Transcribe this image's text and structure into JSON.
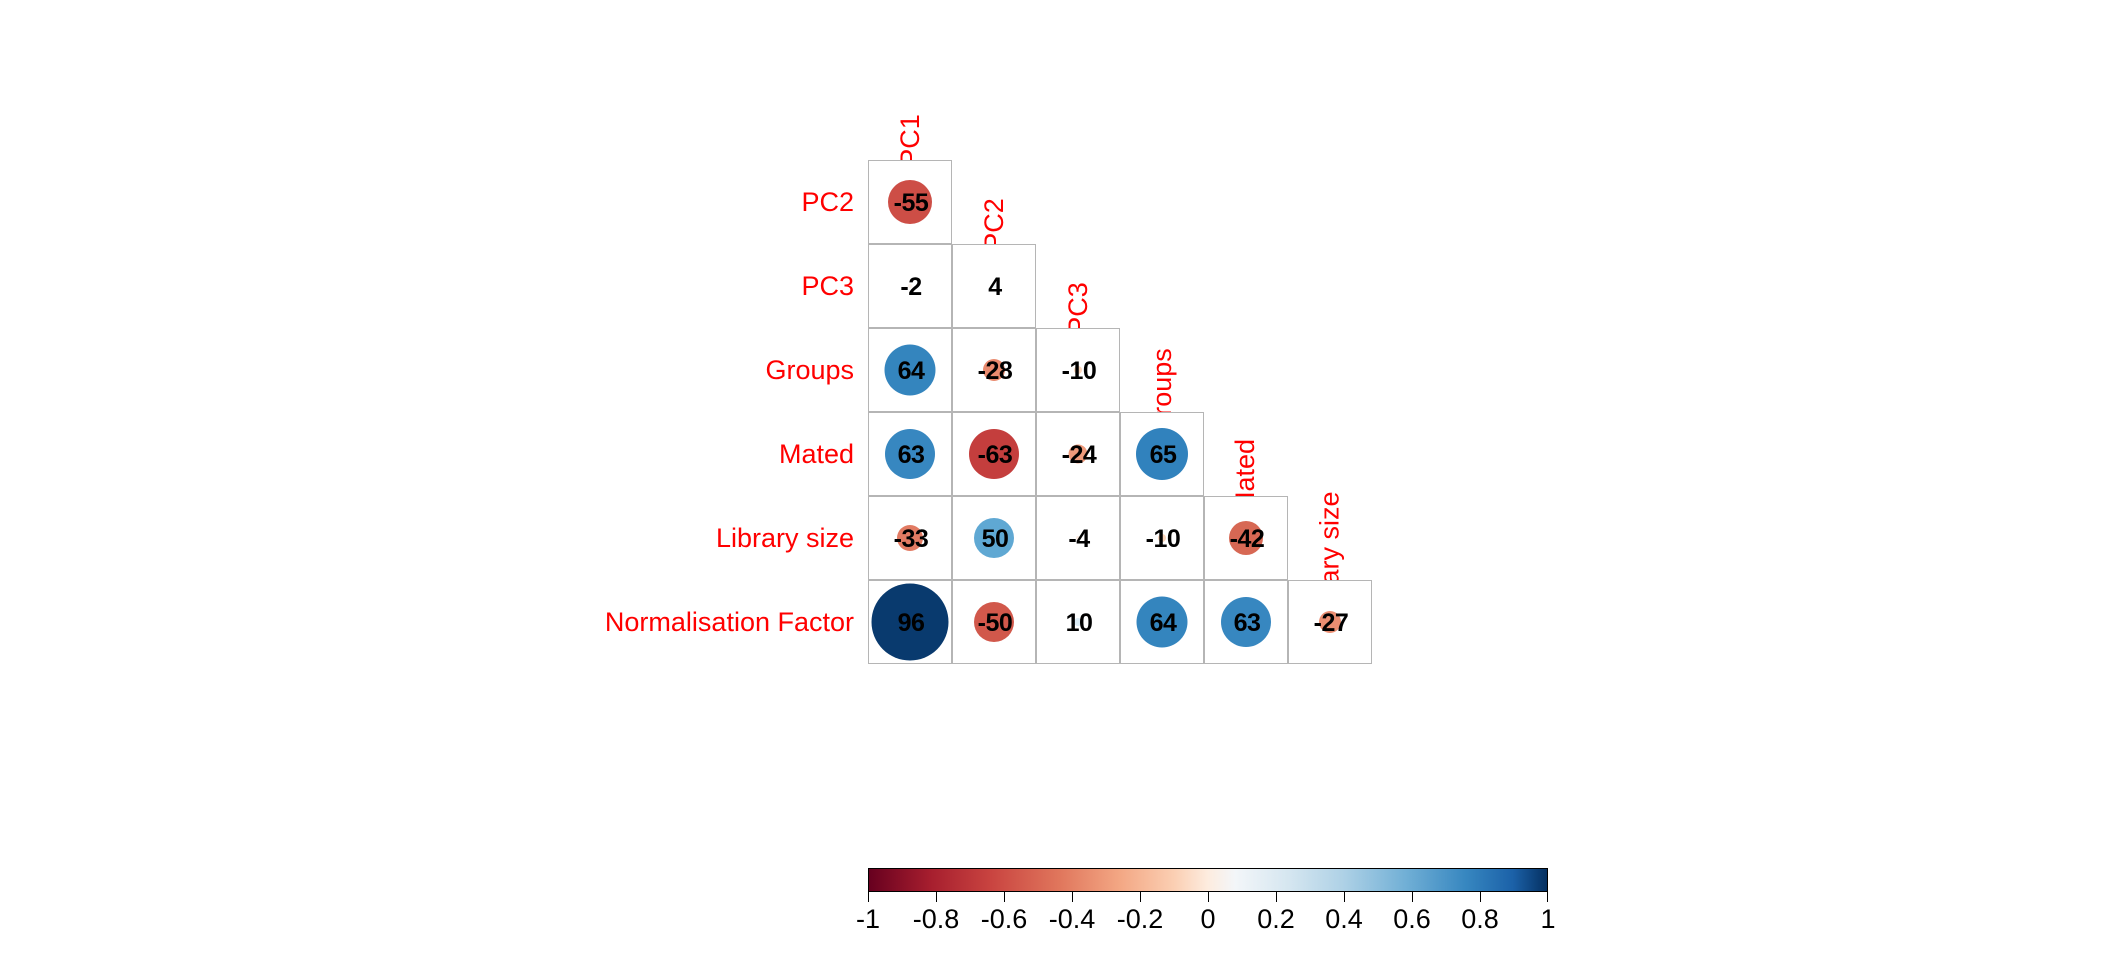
{
  "chart_data": {
    "type": "heatmap",
    "title": "",
    "subtitle": "",
    "xlabel": "",
    "ylabel": "",
    "layout": "lower-triangle-correlogram",
    "method": "circle-with-number",
    "grid": true,
    "value_scale": "percent (correlation x 100)",
    "variables": [
      "PC1",
      "PC2",
      "PC3",
      "Groups",
      "Mated",
      "Library size",
      "Normalisation Factor"
    ],
    "row_labels": [
      "PC2",
      "PC3",
      "Groups",
      "Mated",
      "Library size",
      "Normalisation Factor"
    ],
    "diagonal_labels": [
      "PC1",
      "PC2",
      "PC3",
      "Groups",
      "Mated",
      "Library size"
    ],
    "rows": [
      {
        "label": "PC2",
        "values": [
          -55
        ]
      },
      {
        "label": "PC3",
        "values": [
          -2,
          4
        ]
      },
      {
        "label": "Groups",
        "values": [
          64,
          -28,
          -10
        ]
      },
      {
        "label": "Mated",
        "values": [
          63,
          -63,
          -24,
          65
        ]
      },
      {
        "label": "Library size",
        "values": [
          -33,
          50,
          -4,
          -10,
          -42
        ]
      },
      {
        "label": "Normalisation Factor",
        "values": [
          96,
          -50,
          10,
          64,
          63,
          -27
        ]
      }
    ],
    "cells": [
      {
        "row": "PC2",
        "col": "PC1",
        "value": -55
      },
      {
        "row": "PC3",
        "col": "PC1",
        "value": -2
      },
      {
        "row": "PC3",
        "col": "PC2",
        "value": 4
      },
      {
        "row": "Groups",
        "col": "PC1",
        "value": 64
      },
      {
        "row": "Groups",
        "col": "PC2",
        "value": -28
      },
      {
        "row": "Groups",
        "col": "PC3",
        "value": -10
      },
      {
        "row": "Mated",
        "col": "PC1",
        "value": 63
      },
      {
        "row": "Mated",
        "col": "PC2",
        "value": -63
      },
      {
        "row": "Mated",
        "col": "PC3",
        "value": -24
      },
      {
        "row": "Mated",
        "col": "Groups",
        "value": 65
      },
      {
        "row": "Library size",
        "col": "PC1",
        "value": -33
      },
      {
        "row": "Library size",
        "col": "PC2",
        "value": 50
      },
      {
        "row": "Library size",
        "col": "PC3",
        "value": -4
      },
      {
        "row": "Library size",
        "col": "Groups",
        "value": -10
      },
      {
        "row": "Library size",
        "col": "Mated",
        "value": -42
      },
      {
        "row": "Normalisation Factor",
        "col": "PC1",
        "value": 96
      },
      {
        "row": "Normalisation Factor",
        "col": "PC2",
        "value": -50
      },
      {
        "row": "Normalisation Factor",
        "col": "PC3",
        "value": 10
      },
      {
        "row": "Normalisation Factor",
        "col": "Groups",
        "value": 64
      },
      {
        "row": "Normalisation Factor",
        "col": "Mated",
        "value": 63
      },
      {
        "row": "Normalisation Factor",
        "col": "Library size",
        "value": -27
      }
    ],
    "colorbar": {
      "min": -1,
      "max": 1,
      "ticks": [
        -1,
        -0.8,
        -0.6,
        -0.4,
        -0.2,
        0,
        0.2,
        0.4,
        0.6,
        0.8,
        1
      ],
      "tick_labels": [
        "-1",
        "-0.8",
        "-0.6",
        "-0.4",
        "-0.2",
        "0",
        "0.2",
        "0.4",
        "0.6",
        "0.8",
        "1"
      ],
      "position": "bottom",
      "negative_color": "#67001f",
      "mid_color": "#f7f7f7",
      "positive_color": "#053061"
    },
    "colors": {
      "label_color": "#ff0000",
      "value_text_color": "#000000",
      "grid_line_color": "#b5b5b5",
      "background": "#ffffff"
    }
  }
}
